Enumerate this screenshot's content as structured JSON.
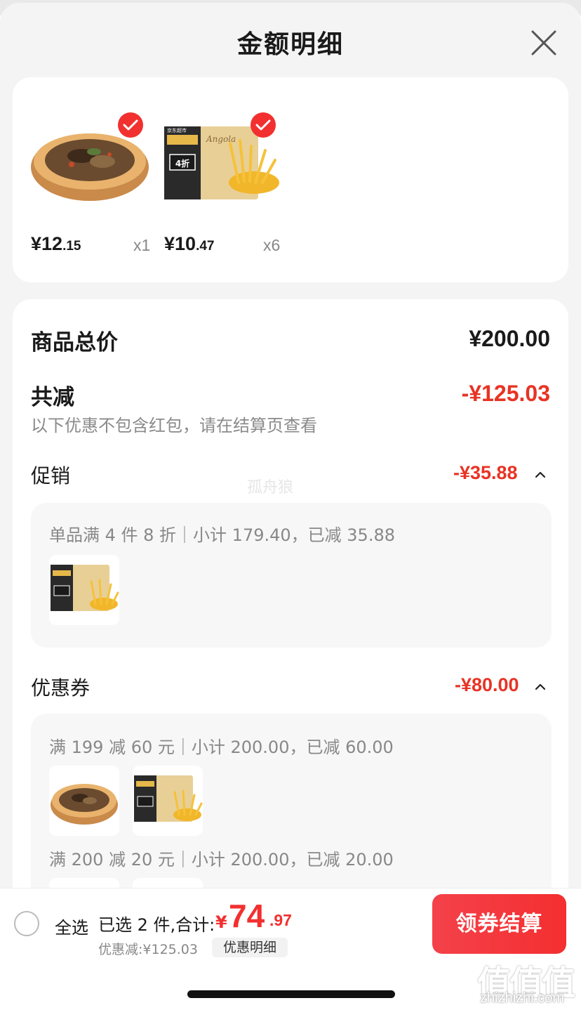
{
  "sheet": {
    "title": "金额明细"
  },
  "products": [
    {
      "price_int": "¥12",
      "price_frac": ".15",
      "qty": "x1",
      "image": "braised-meat-bowl-image"
    },
    {
      "price_int": "¥10",
      "price_frac": ".47",
      "qty": "x6",
      "image": "fries-package-image"
    }
  ],
  "fries_package_text": {
    "brand": "Angola",
    "store": "京东超市",
    "badge": "4折"
  },
  "summary": {
    "total_label": "商品总价",
    "total_value": "¥200.00",
    "reduce_label": "共减",
    "reduce_value": "-¥125.03",
    "note": "以下优惠不包含红包，请在结算页查看"
  },
  "promotion": {
    "label": "促销",
    "amount": "-¥35.88",
    "rule": "单品满 4 件 8 折｜小计 179.40，已减 35.88"
  },
  "coupons": {
    "label": "优惠券",
    "amount": "-¥80.00",
    "rules": [
      "满 199 减 60 元｜小计 200.00，已减 60.00",
      "满 200 减 20 元｜小计 200.00，已减 20.00"
    ]
  },
  "watermark": "孤舟狼",
  "bottom_bar": {
    "select_all": "全选",
    "selected_text": "已选 2 件,合计:",
    "yen": "¥",
    "total_int": "74",
    "total_frac": ".97",
    "discount_text": "优惠减:¥125.03",
    "detail_link": "优惠明细",
    "checkout_label": "领券结算"
  },
  "site_watermark": {
    "logo": "值值值",
    "url": "zhizhizhi.com"
  },
  "colors": {
    "accent_red": "#f23030",
    "amount_red": "#e83325"
  }
}
